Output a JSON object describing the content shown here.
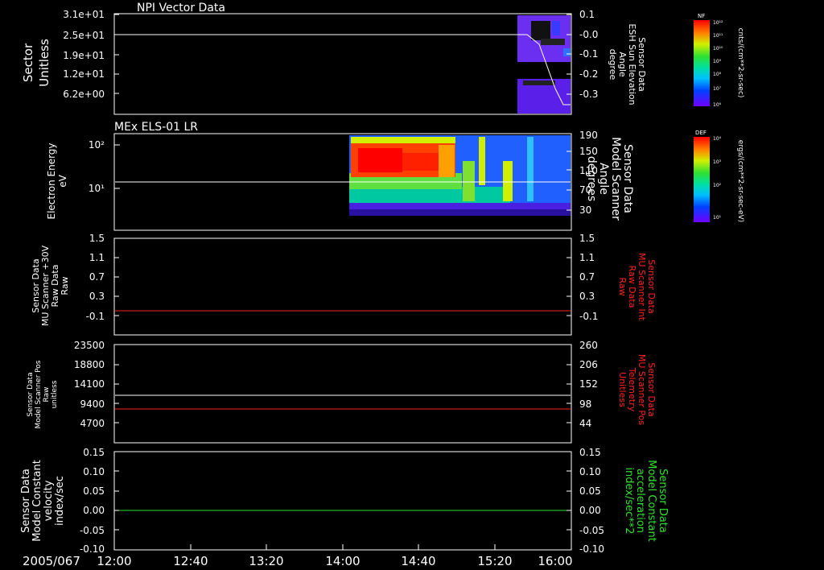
{
  "panel1": {
    "title": "NPI Vector Data",
    "left_ylabel": [
      "Sector",
      "Unitless"
    ],
    "left_ticks": [
      "3.1e+01",
      "2.5e+01",
      "1.9e+01",
      "1.2e+01",
      "6.2e+00"
    ],
    "right_ticks": [
      "0.1",
      "-0.0",
      "-0.1",
      "-0.2",
      "-0.3"
    ],
    "right_ylabel": [
      "Sensor Data",
      "ESH Sun Elevation",
      "Angle",
      "degree"
    ],
    "colorbar_label": "NF",
    "colorbar_ticks": [
      "10¹²",
      "10¹¹",
      "10¹⁰",
      "10⁹",
      "10⁸",
      "10⁷",
      "10⁶"
    ],
    "colorbar_units": "cnts/(cm**2-sr-sec)"
  },
  "panel2": {
    "title": "MEx ELS-01 LR",
    "left_ylabel": [
      "Electron Energy",
      "eV"
    ],
    "left_ticks": [
      "10²",
      "10¹"
    ],
    "right_ticks": [
      "190",
      "150",
      "110",
      "70",
      "30"
    ],
    "right_ylabel": [
      "Sensor Data",
      "Model Scanner",
      "Angle",
      "degrees"
    ],
    "colorbar_label": "DEF",
    "colorbar_ticks": [
      "10⁴",
      "10³",
      "10²",
      "10¹"
    ],
    "colorbar_units": "ergs/(cm**2-sr-sec-eV)"
  },
  "panel3": {
    "left_ylabel": [
      "Sensor Data",
      "MU Scanner +30V",
      "Raw Data",
      "Raw"
    ],
    "left_ticks": [
      "1.5",
      "1.1",
      "0.7",
      "0.3",
      "-0.1"
    ],
    "right_ticks": [
      "1.5",
      "1.1",
      "0.7",
      "0.3",
      "-0.1"
    ],
    "right_ylabel": [
      "Sensor Data",
      "MU Scanner Int",
      "Raw Data",
      "Raw"
    ]
  },
  "panel4": {
    "left_ylabel": [
      "Sensor Data",
      "Model Scanner Pos",
      "Raw",
      "unitless"
    ],
    "left_ticks": [
      "23500",
      "18800",
      "14100",
      "9400",
      "4700"
    ],
    "right_ticks": [
      "260",
      "206",
      "152",
      "98",
      "44"
    ],
    "right_ylabel": [
      "Sensor Data",
      "MU Scanner Pos",
      "Telemetry",
      "Unitless"
    ]
  },
  "panel5": {
    "left_ylabel": [
      "Sensor Data",
      "Model Constant",
      "velocity",
      "index/sec"
    ],
    "left_ticks": [
      "0.15",
      "0.10",
      "0.05",
      "0.00",
      "-0.05",
      "-0.10"
    ],
    "right_ticks": [
      "0.15",
      "0.10",
      "0.05",
      "0.00",
      "-0.05",
      "-0.10"
    ],
    "right_ylabel": [
      "Sensor Data",
      "Model Constant",
      "acceleration",
      "index/sec**2"
    ]
  },
  "xaxis": {
    "date": "2005/067",
    "ticks": [
      "12:00",
      "12:40",
      "13:20",
      "14:00",
      "14:40",
      "15:20",
      "16:00"
    ]
  },
  "colors": {
    "white": "#ffffff",
    "red": "#ff2020",
    "green": "#30e030"
  },
  "chart_data": [
    {
      "type": "heatmap",
      "title": "NPI Vector Data",
      "ylabel": "Sector Unitless",
      "y2label": "Sensor Data ESH Sun Elevation Angle degree",
      "xlim": [
        "12:00",
        "16:00"
      ],
      "data_start": "15:30",
      "line_series": {
        "name": "ESH Sun Elevation Angle",
        "x": [
          "12:00",
          "15:30",
          "15:40",
          "15:50",
          "16:00"
        ],
        "y": [
          -0.02,
          -0.02,
          -0.12,
          -0.34,
          -0.34
        ]
      }
    },
    {
      "type": "heatmap",
      "title": "MEx ELS-01 LR",
      "ylabel": "Electron Energy eV",
      "y2label": "Sensor Data Model Scanner Angle degrees",
      "yscale": "log",
      "xlim": [
        "12:00",
        "16:00"
      ],
      "data_start": "14:03",
      "line_series": {
        "name": "Model Scanner Angle",
        "x": [
          "12:00",
          "16:00"
        ],
        "y": [
          90,
          90
        ]
      }
    },
    {
      "type": "line",
      "ylim": [
        -0.3,
        1.5
      ],
      "series": [
        {
          "name": "MU Scanner Int Raw Data",
          "color": "red",
          "x": [
            "12:00",
            "16:00"
          ],
          "y": [
            -0.05,
            -0.05
          ]
        }
      ]
    },
    {
      "type": "line",
      "ylim": [
        0,
        23500
      ],
      "y2lim": [
        0,
        260
      ],
      "series": [
        {
          "name": "Model Scanner Pos Raw",
          "color": "white",
          "x": [
            "12:00",
            "16:00"
          ],
          "y": [
            11400,
            11400
          ]
        },
        {
          "name": "MU Scanner Pos Telemetry",
          "color": "red",
          "x": [
            "12:00",
            "16:00"
          ],
          "y": [
            90,
            90
          ]
        }
      ]
    },
    {
      "type": "line",
      "ylim": [
        -0.1,
        0.15
      ],
      "series": [
        {
          "name": "Model Constant velocity",
          "color": "green",
          "x": [
            "12:00",
            "16:00"
          ],
          "y": [
            0.0,
            0.0
          ]
        }
      ]
    }
  ]
}
